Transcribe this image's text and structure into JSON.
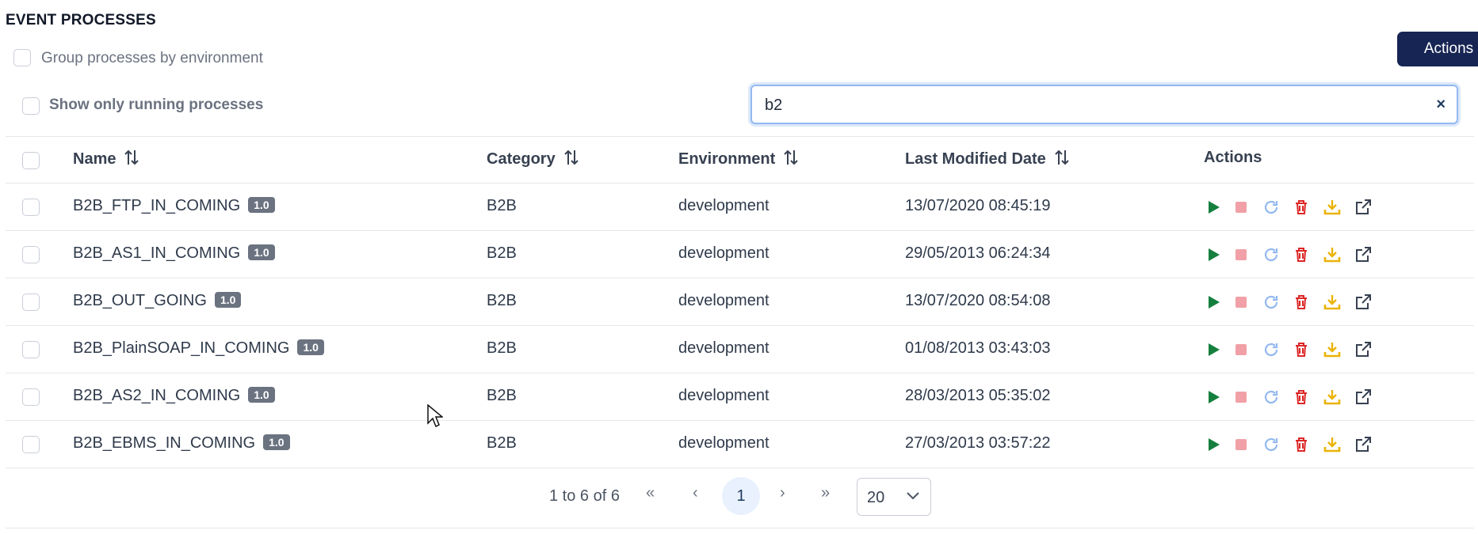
{
  "header": {
    "title": "EVENT PROCESSES",
    "actions_button": "Actions"
  },
  "options": {
    "group_by_env": "Group processes by environment",
    "show_running": "Show only running processes"
  },
  "search": {
    "value": "b2",
    "clear_symbol": "×"
  },
  "table": {
    "columns": {
      "name": "Name",
      "category": "Category",
      "environment": "Environment",
      "last_modified": "Last Modified Date",
      "actions": "Actions"
    },
    "rows": [
      {
        "name": "B2B_FTP_IN_COMING",
        "version": "1.0",
        "category": "B2B",
        "environment": "development",
        "last_modified": "13/07/2020 08:45:19"
      },
      {
        "name": "B2B_AS1_IN_COMING",
        "version": "1.0",
        "category": "B2B",
        "environment": "development",
        "last_modified": "29/05/2013 06:24:34"
      },
      {
        "name": "B2B_OUT_GOING",
        "version": "1.0",
        "category": "B2B",
        "environment": "development",
        "last_modified": "13/07/2020 08:54:08"
      },
      {
        "name": "B2B_PlainSOAP_IN_COMING",
        "version": "1.0",
        "category": "B2B",
        "environment": "development",
        "last_modified": "01/08/2013 03:43:03"
      },
      {
        "name": "B2B_AS2_IN_COMING",
        "version": "1.0",
        "category": "B2B",
        "environment": "development",
        "last_modified": "28/03/2013 05:35:02"
      },
      {
        "name": "B2B_EBMS_IN_COMING",
        "version": "1.0",
        "category": "B2B",
        "environment": "development",
        "last_modified": "27/03/2013 03:57:22"
      }
    ],
    "row_action_icons": [
      "play-icon",
      "stop-icon",
      "restart-icon",
      "delete-icon",
      "download-icon",
      "open-external-icon"
    ]
  },
  "pagination": {
    "summary": "1 to 6 of 6",
    "first": "«",
    "prev": "‹",
    "current_page": "1",
    "next": "›",
    "last": "»",
    "page_size": "20"
  },
  "colors": {
    "primary": "#172554",
    "play": "#15803d",
    "stop": "#f0a0a6",
    "restart": "#93b8ef",
    "delete": "#dc2626",
    "download": "#eab308",
    "open": "#374151"
  }
}
